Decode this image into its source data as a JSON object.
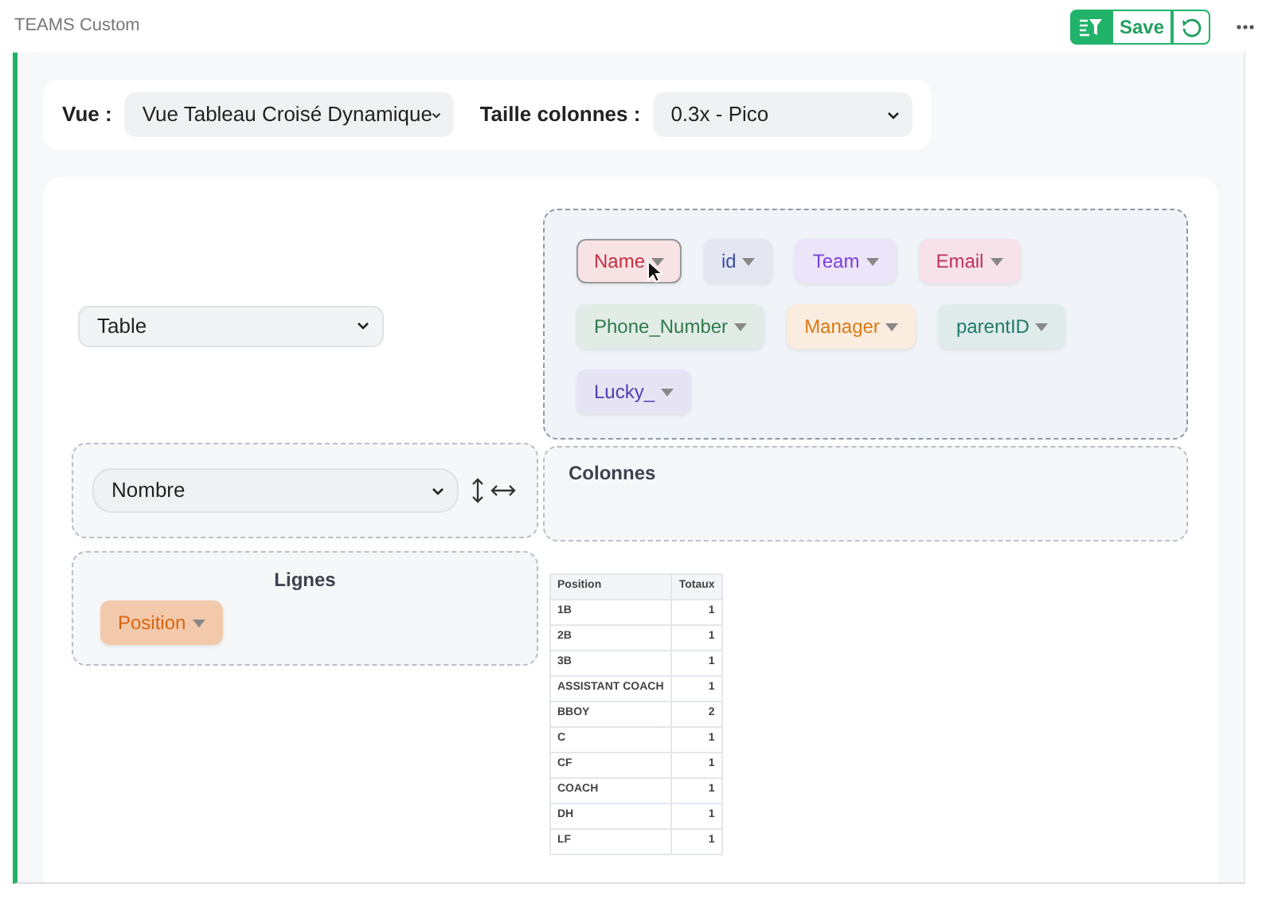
{
  "header": {
    "title": "TEAMS Custom",
    "save_label": "Save"
  },
  "settings": [
    {
      "label": "Vue :",
      "value": "Vue Tableau Croisé Dynamique"
    },
    {
      "label": "Taille colonnes :",
      "value": "0.3x - Pico"
    }
  ],
  "renderer": {
    "value": "Table"
  },
  "aggregator": {
    "value": "Nombre"
  },
  "fields": [
    {
      "label": "Name",
      "color": "#c53040",
      "highlighted": true
    },
    {
      "label": "id",
      "color": "#3d4fa0",
      "highlighted": false
    },
    {
      "label": "Team",
      "color": "#7a3fd6",
      "highlighted": false
    },
    {
      "label": "Email",
      "color": "#c0305e",
      "highlighted": false
    },
    {
      "label": "Phone_Number",
      "color": "#2f7a4a",
      "highlighted": false
    },
    {
      "label": "Manager",
      "color": "#d97a14",
      "highlighted": false
    },
    {
      "label": "parentID",
      "color": "#1f7a6a",
      "highlighted": false
    },
    {
      "label": "Lucky_",
      "color": "#4a3fb0",
      "highlighted": false
    }
  ],
  "columns_zone": {
    "title": "Colonnes"
  },
  "rows_zone": {
    "title": "Lignes",
    "fields": [
      {
        "label": "Position",
        "color": "#d9650f",
        "highlighted": false
      }
    ]
  },
  "table": {
    "columns": [
      "Position",
      "Totaux"
    ],
    "rows": [
      [
        "1B",
        "1"
      ],
      [
        "2B",
        "1"
      ],
      [
        "3B",
        "1"
      ],
      [
        "ASSISTANT COACH",
        "1"
      ],
      [
        "BBOY",
        "2"
      ],
      [
        "C",
        "1"
      ],
      [
        "CF",
        "1"
      ],
      [
        "COACH",
        "1"
      ],
      [
        "DH",
        "1"
      ],
      [
        "LF",
        "1"
      ]
    ]
  }
}
